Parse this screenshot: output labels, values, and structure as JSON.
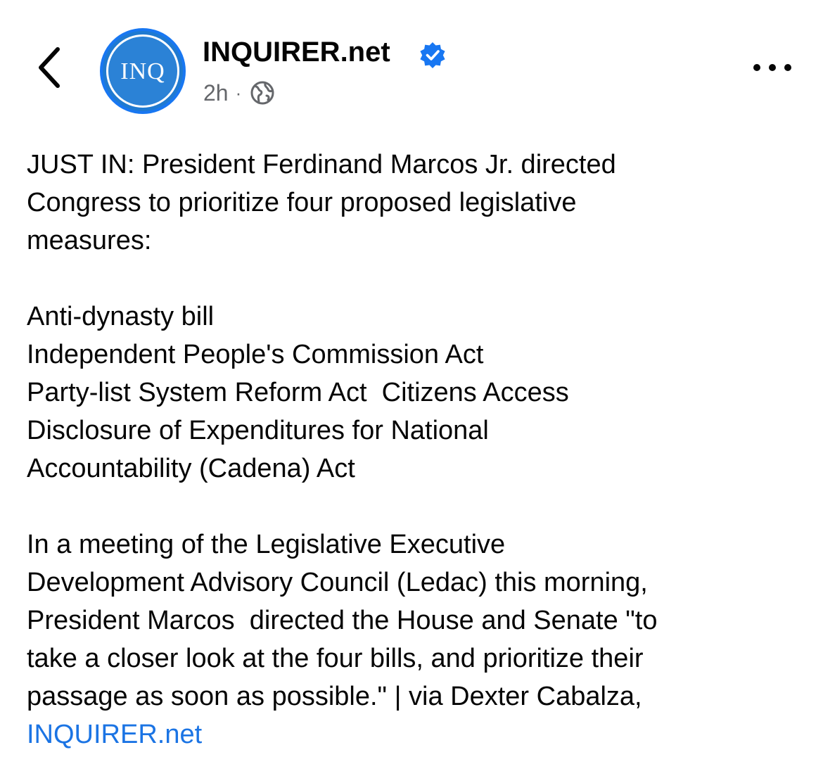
{
  "header": {
    "page_name": "INQUIRER.net",
    "avatar_text": "INQ",
    "timestamp": "2h",
    "separator": "·",
    "audience_icon": "globe-icon",
    "back_icon": "chevron-left-icon",
    "more_icon": "more-horizontal-icon",
    "verified_icon": "verified-badge-icon"
  },
  "post": {
    "intro": [
      "JUST IN: President Ferdinand Marcos Jr. directed",
      "Congress to prioritize four proposed legislative",
      "measures:"
    ],
    "measures": [
      "Anti-dynasty bill",
      "Independent People's Commission Act",
      "Party-list System Reform Act  Citizens Access",
      "Disclosure of Expenditures for National",
      "Accountability (Cadena) Act"
    ],
    "body": [
      "In a meeting of the Legislative Executive",
      "Development Advisory Council (Ledac) this morning,",
      "President Marcos  directed the House and Senate \"to",
      "take a closer look at the four bills, and prioritize their",
      "passage as soon as possible.\" | via Dexter Cabalza,"
    ],
    "link_text": "INQUIRER.net"
  },
  "colors": {
    "text": "#050505",
    "secondary": "#65676b",
    "link": "#1b74e4",
    "verified": "#1877f2",
    "avatar": "#2b82d6"
  }
}
